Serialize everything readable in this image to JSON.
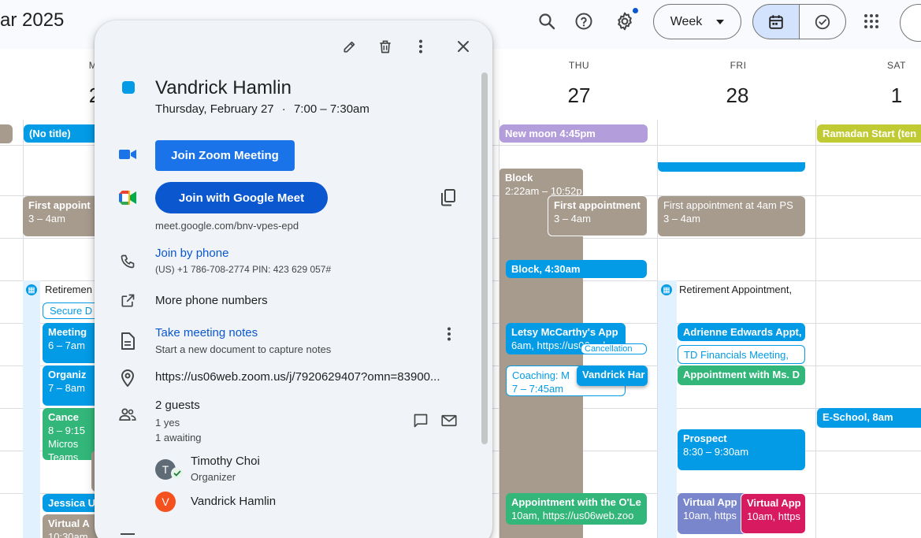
{
  "header": {
    "title": "ar 2025",
    "view_label": "Week"
  },
  "days": [
    {
      "dow": "M",
      "num": "2"
    },
    {
      "dow": "THU",
      "num": "27"
    },
    {
      "dow": "FRI",
      "num": "28"
    },
    {
      "dow": "SAT",
      "num": "1"
    }
  ],
  "all_day": {
    "mon": "(No title)",
    "thu": "New moon 4:45pm",
    "sat": "Ramadan Start (ten"
  },
  "events": {
    "mon_first_appt_title": "First appoint",
    "mon_first_appt_time": "3 – 4am",
    "mon_retirement": "Retiremen",
    "mon_secure": "Secure D",
    "mon_meeting_title": "Meeting",
    "mon_meeting_time": "6 – 7am",
    "mon_organiz_title": "Organiz",
    "mon_organiz_time": "7 – 8am",
    "mon_cancel_title": "Cance",
    "mon_cancel_time": "8 – 9:15",
    "mon_cancel_l3": "Micros",
    "mon_cancel_l4": "Teams",
    "mon_jessica": "Jessica U",
    "mon_virtual_title": "Virtual A",
    "mon_virtual_time": "10:30am",
    "thu_block_title": "Block",
    "thu_block_time": "2:22am – 10:52p",
    "thu_first_appt_title": "First appointment",
    "thu_first_appt_time": "3 – 4am",
    "thu_block430": "Block, 4:30am",
    "thu_letsy_title": "Letsy McCarthy's App",
    "thu_letsy_time": "6am, https://us06web",
    "thu_cancellation": "Cancellation",
    "thu_coaching_title": "Coaching: M",
    "thu_coaching_time": "7 – 7:45am",
    "thu_vandrick": "Vandrick Har",
    "thu_oleary_title": "Appointment with the O'Le",
    "thu_oleary_time": "10am, https://us06web.zoo",
    "fri_first_appt_title": "First appointment at 4am PS",
    "fri_first_appt_time": "3 – 4am",
    "fri_retirement": "Retirement Appointment,",
    "fri_adrienne": "Adrienne Edwards Appt,",
    "fri_td": "TD Financials Meeting,",
    "fri_ms_d": "Appointment with Ms. D",
    "fri_prospect_title": "Prospect",
    "fri_prospect_time": "8:30 – 9:30am",
    "fri_virtual1_title": "Virtual App",
    "fri_virtual1_time": "10am, https",
    "fri_virtual2_title": "Virtual App",
    "fri_virtual2_time": "10am, https",
    "sat_eschool": "E-School, 8am"
  },
  "popover": {
    "title": "Vandrick Hamlin",
    "date": "Thursday, February 27",
    "separator": "·",
    "time": "7:00 – 7:30am",
    "zoom_label": "Join Zoom Meeting",
    "meet_label": "Join with Google Meet",
    "meet_url": "meet.google.com/bnv-vpes-epd",
    "phone_label": "Join by phone",
    "phone_detail": "(US) +1 786-708-2774 PIN: 423 629 057#",
    "more_phones": "More phone numbers",
    "notes_label": "Take meeting notes",
    "notes_detail": "Start a new document to capture notes",
    "location": "https://us06web.zoom.us/j/7920629407?omn=83900...",
    "guests_count": "2 guests",
    "guests_yes": "1 yes",
    "guests_awaiting": "1 awaiting",
    "guest1_initial": "T",
    "guest1_name": "Timothy Choi",
    "guest1_role": "Organizer",
    "guest2_initial": "V",
    "guest2_name": "Vandrick Hamlin"
  },
  "colors": {
    "accent": "#0b57d0",
    "event_blue": "#039be5",
    "event_grey": "#a79b8e",
    "event_green": "#33b679"
  }
}
